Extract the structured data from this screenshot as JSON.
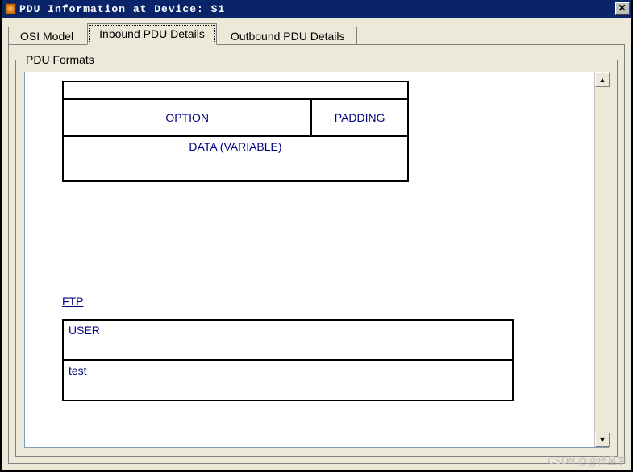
{
  "window": {
    "title": "PDU Information at Device: S1"
  },
  "tabs": {
    "t0": "OSI Model",
    "t1": "Inbound PDU Details",
    "t2": "Outbound PDU Details",
    "active_index": 1
  },
  "group": {
    "title": "PDU Formats"
  },
  "pdu_fragment": {
    "option": "OPTION",
    "padding": "PADDING",
    "data": "DATA (VARIABLE)"
  },
  "ftp": {
    "label": "FTP",
    "command": "USER",
    "arg": "test"
  },
  "watermark": "CSDN @@杨星宇"
}
